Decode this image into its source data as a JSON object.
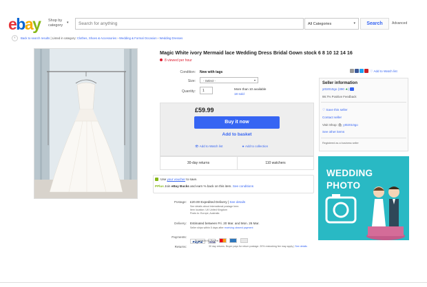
{
  "header": {
    "logo_letters": [
      {
        "ch": "e",
        "color": "#e53238"
      },
      {
        "ch": "b",
        "color": "#0064d2"
      },
      {
        "ch": "a",
        "color": "#f5af02"
      },
      {
        "ch": "y",
        "color": "#86b817"
      }
    ],
    "shop_by_line1": "Shop by",
    "shop_by_line2": "category",
    "search_placeholder": "Search for anything",
    "category_select": "All Categories",
    "search_button": "Search",
    "advanced_link": "Advanced"
  },
  "breadcrumb": {
    "back": "Back to search results",
    "listed_in": "Listed in category:",
    "path": [
      "Clothes, Shoes & Accessories",
      "Wedding & Formal Occasion",
      "Wedding Dresses"
    ]
  },
  "item": {
    "title": "Magic White ivory Mermaid lace Wedding Dress Bridal Gown stock 6 8 10 12 14 16",
    "viewed": "8 viewed per hour",
    "condition_label": "Condition:",
    "condition_value": "New with tags",
    "size_label": "Size:",
    "size_select": "- Select -",
    "quantity_label": "Quantity:",
    "quantity_value": "1",
    "available": "More than 10 available",
    "sold": "18 sold",
    "price": "£59.99",
    "buy_now": "Buy it now",
    "add_basket": "Add to basket",
    "add_watch": "Add to Watch list",
    "add_collection": "Add to collection",
    "returns_stat": "30-day returns",
    "watchers_stat": "110 watchers"
  },
  "promo": {
    "voucher_pre": "Use",
    "voucher_link": "your voucher",
    "voucher_post": "to save.",
    "pp_label": "PPlus",
    "join_pre": "Join",
    "join_bold": "eBay Bucks",
    "join_post": "and earn % back on this item.",
    "join_link": "See conditions"
  },
  "shipping": {
    "postage_label": "Postage:",
    "postage_value": "£20.00  Expedited Delivery",
    "postage_link": "See details",
    "postage_note1": "See details about international postage here.",
    "postage_note2": "Item location:  UK United Kingdom",
    "postage_note3": "Posts to:  Europe, Australia",
    "delivery_label": "Delivery:",
    "delivery_value": "Estimated between Fri. 20 Mar. and Mon. 26 Mar.",
    "delivery_note": "Seller ships within 5 days after",
    "delivery_note_link": "receiving cleared payment",
    "payments_label": "Payments:",
    "payments_note": "Processed by PayPal",
    "returns_label": "Returns:",
    "returns_value": "30 day returns. Buyer pays for return postage. 20% restocking fee may apply",
    "returns_link": "See details"
  },
  "seller": {
    "share_text": "Add to Watch list",
    "title": "Seller information",
    "name": "yt02010go (390",
    "name_close": ")",
    "feedback": "98.7% Positive Feedback",
    "save": "Save this seller",
    "contact": "Contact seller",
    "visit_label": "Visit Shop:",
    "visit_shop": "yt02010go",
    "other": "See other items",
    "registered": "Registered as a business seller"
  },
  "ad": {
    "line1": "WEDDING",
    "line2": "PHOTO",
    "bg_color": "#29b9c4"
  },
  "colors": {
    "link": "#3665f3",
    "primary_button": "#3665f3",
    "alert_red": "#dd1e31"
  }
}
